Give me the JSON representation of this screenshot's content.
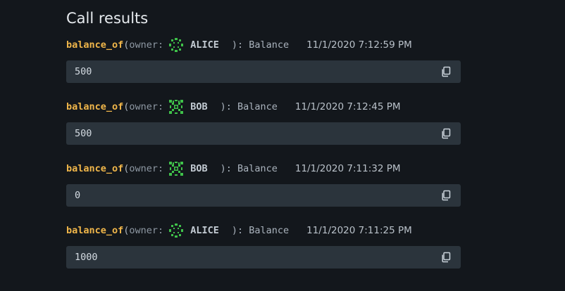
{
  "page": {
    "title": "Call results"
  },
  "results": [
    {
      "fn": "balance_of",
      "open": "(",
      "param": "owner:",
      "account": "ALICE",
      "avatar": "alice-identicon",
      "close": "): Balance",
      "time": "11/1/2020 7:12:59 PM",
      "value": "500"
    },
    {
      "fn": "balance_of",
      "open": "(",
      "param": "owner:",
      "account": "BOB",
      "avatar": "bob-identicon",
      "close": "): Balance",
      "time": "11/1/2020 7:12:45 PM",
      "value": "500"
    },
    {
      "fn": "balance_of",
      "open": "(",
      "param": "owner:",
      "account": "BOB",
      "avatar": "bob-identicon",
      "close": "): Balance",
      "time": "11/1/2020 7:11:32 PM",
      "value": "0"
    },
    {
      "fn": "balance_of",
      "open": "(",
      "param": "owner:",
      "account": "ALICE",
      "avatar": "alice-identicon",
      "close": "): Balance",
      "time": "11/1/2020 7:11:25 PM",
      "value": "1000"
    }
  ],
  "icons": {
    "copy": "copy-icon"
  },
  "colors": {
    "function": "#f0b64a",
    "identicon": "#3fc24a",
    "background": "#13171c",
    "result_box": "#2b343c"
  }
}
